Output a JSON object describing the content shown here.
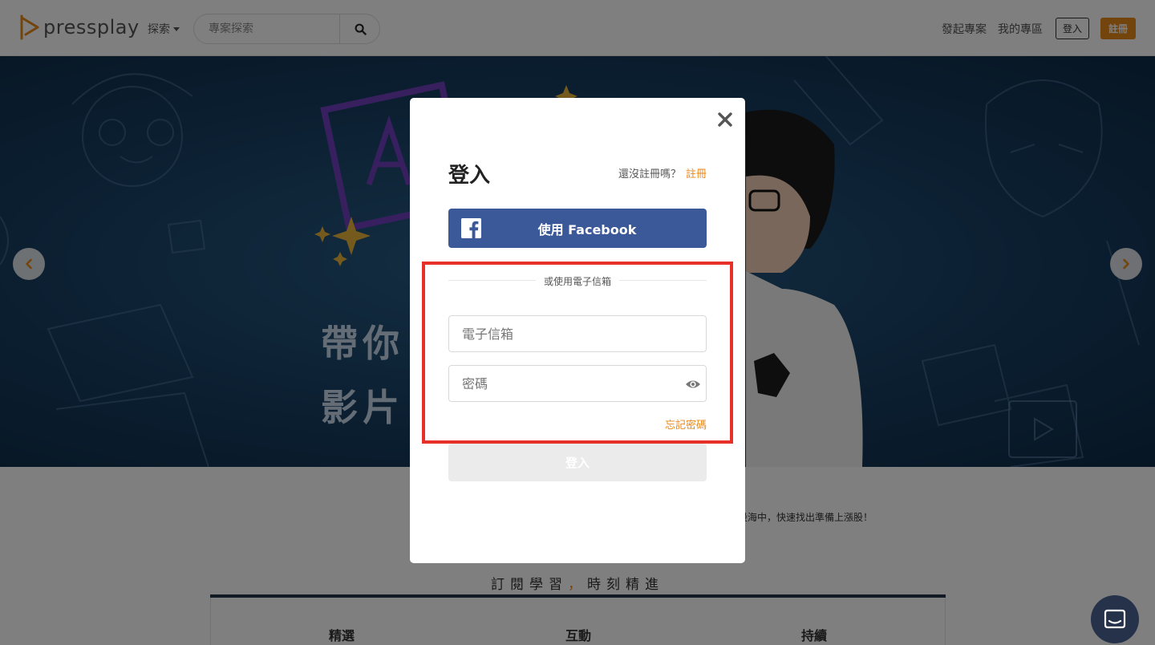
{
  "header": {
    "logo_text": "pressplay",
    "explore_label": "探索",
    "search_placeholder": "專案探索",
    "nav": {
      "start_project": "發起專案",
      "my_zone": "我的專區",
      "login": "登入",
      "register": "註冊"
    }
  },
  "hero": {
    "title_line1": "帶你",
    "title_line2": "影片"
  },
  "below": {
    "tagline": "股海中，快速找出準備上漲股！",
    "section_title_a": "訂閱學習",
    "section_title_comma": "，",
    "section_title_b": "時刻精進",
    "plan_columns": [
      "精選",
      "互動",
      "持續"
    ]
  },
  "modal": {
    "title": "登入",
    "signup_prompt": "還沒註冊嗎？",
    "signup_link": "註冊",
    "facebook_button": "使用 Facebook",
    "divider_text": "或使用電子信箱",
    "email_placeholder": "電子信箱",
    "password_placeholder": "密碼",
    "forgot_password": "忘記密碼",
    "submit": "登入"
  },
  "colors": {
    "brand_orange": "#e9891a",
    "facebook_blue": "#3b5998",
    "highlight_red": "#e8302a",
    "hero_navy": "#173f63"
  },
  "icons": [
    "logo-play-icon",
    "chevron-down-icon",
    "search-icon",
    "chevron-left-icon",
    "chevron-right-icon",
    "close-icon",
    "facebook-icon",
    "eye-icon",
    "chat-icon"
  ]
}
